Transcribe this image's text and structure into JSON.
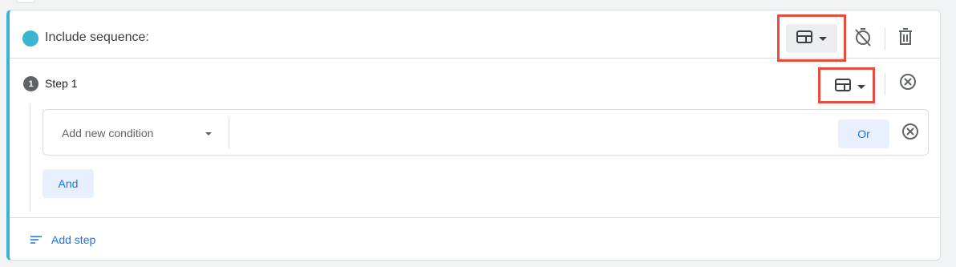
{
  "sequence": {
    "title": "Include sequence:",
    "accent_color": "#3bb4cf",
    "scope_icon": "table-layout-icon",
    "timer_icon": "timer-off-icon",
    "delete_icon": "trash-icon"
  },
  "step": {
    "number": "1",
    "label": "Step 1",
    "remove_icon": "close-circle-icon"
  },
  "condition": {
    "placeholder": "Add new condition",
    "or_label": "Or",
    "remove_icon": "close-circle-icon"
  },
  "and_label": "And",
  "add_step_label": "Add step",
  "highlight_color": "#e74c3c"
}
